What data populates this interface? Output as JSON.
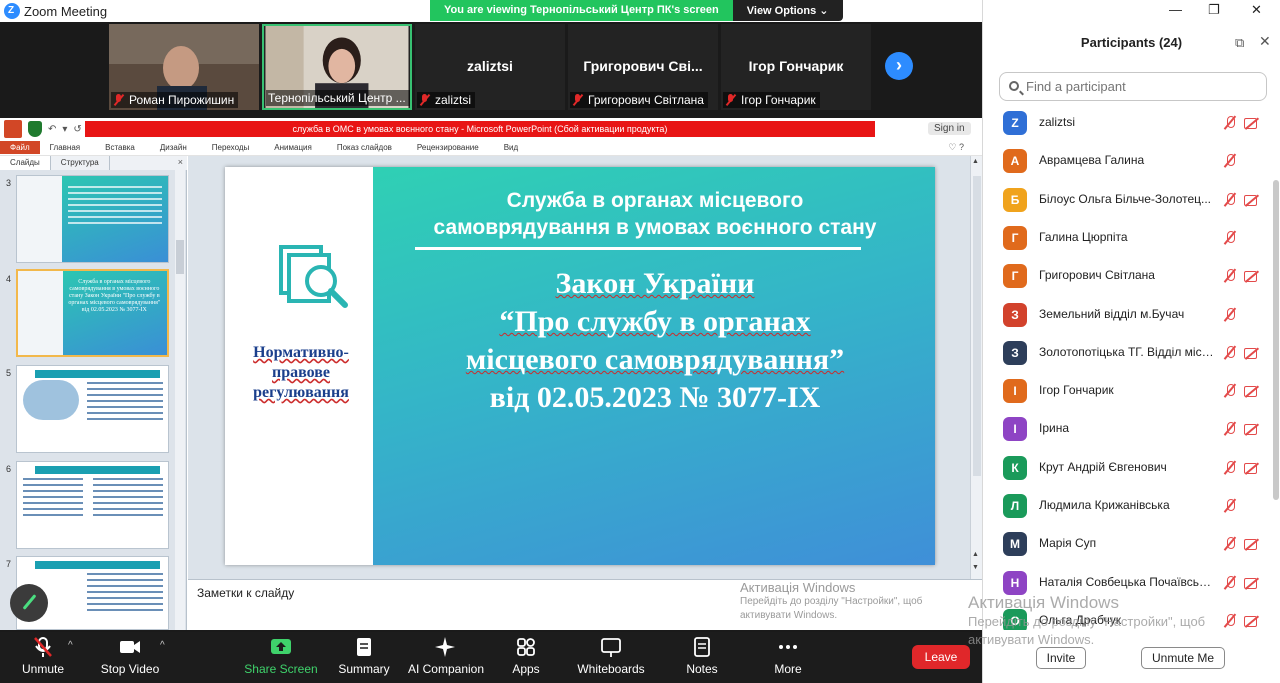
{
  "window": {
    "title": "Zoom Meeting"
  },
  "banner": {
    "message": "You are viewing Тернопільський Центр ПК's screen",
    "options_label": "View Options"
  },
  "window_controls": {
    "minimize": "—",
    "restore": "❐",
    "close": "✕"
  },
  "videos": [
    {
      "name": "Роман Пирожишин",
      "muted": true
    },
    {
      "name": "Тернопільський Центр ...",
      "muted": false,
      "active": true
    },
    {
      "name": "zaliztsi",
      "big_name": "zaliztsi",
      "muted": true
    },
    {
      "name": "Григорович Світлана",
      "big_name": "Григорович  Сві...",
      "muted": true
    },
    {
      "name": "Ігор Гончарик",
      "big_name": "Ігор Гончарик",
      "muted": true
    }
  ],
  "video_next_label": "›",
  "ppt": {
    "window_title": "служба в ОМС в умовах воєнного стану  -  Microsoft PowerPoint (Сбой активации продукта)",
    "sign_in": "Sign in",
    "qat": [
      "↶",
      "▾",
      "↺",
      "▾"
    ],
    "menu": [
      "Файл",
      "Главная",
      "Вставка",
      "Дизайн",
      "Переходы",
      "Анимация",
      "Показ слайдов",
      "Рецензирование",
      "Вид"
    ],
    "help": "♡ ?",
    "panel_tabs": [
      "Слайды",
      "Структура"
    ],
    "panel_close": "×",
    "thumbs": [
      {
        "num": "3"
      },
      {
        "num": "4",
        "text": "Служба в органах місцевого самоврядування в умовах воєнного стану Закон України \"Про службу в органах місцевого самоврядування\" від 02.05.2023 № 3077-IX"
      },
      {
        "num": "5"
      },
      {
        "num": "6"
      },
      {
        "num": "7"
      }
    ],
    "slide": {
      "left_label_lines": [
        "Нормативно-",
        "правове",
        "регулювання"
      ],
      "heading_lines": [
        "Служба в органах місцевого",
        "самоврядування в умовах воєнного стану"
      ],
      "law_lines": [
        "Закон України",
        "“Про службу в органах",
        "місцевого самоврядування”",
        "від 02.05.2023 № 3077-IX"
      ]
    },
    "notes_placeholder": "Заметки к слайду",
    "activation": {
      "title": "Активація Windows",
      "line1": "Перейдіть до розділу \"Настройки\", щоб",
      "line2": "активувати Windows."
    }
  },
  "toolbar": {
    "items": [
      "Unmute",
      "Stop Video",
      "Share Screen",
      "Summary",
      "AI Companion",
      "Apps",
      "Whiteboards",
      "Notes",
      "More"
    ],
    "leave": "Leave",
    "caret": "^"
  },
  "participants": {
    "title": "Participants (24)",
    "search_placeholder": "Find a participant",
    "list": [
      {
        "initial": "Z",
        "name": "zaliztsi",
        "color": "#2f6fd6",
        "mic_muted": true,
        "video_off": true
      },
      {
        "initial": "А",
        "name": "Аврамцева Галина",
        "color": "#e06a1c",
        "mic_muted": true,
        "video_off": false
      },
      {
        "initial": "Б",
        "name": "Білоус Ольга  Більче-Золотец...",
        "color": "#f0a31c",
        "mic_muted": true,
        "video_off": true
      },
      {
        "initial": "Г",
        "name": "Галина Цюрпіта",
        "color": "#e06a1c",
        "mic_muted": true,
        "video_off": false
      },
      {
        "initial": "Г",
        "name": "Григорович Світлана",
        "color": "#e06a1c",
        "mic_muted": true,
        "video_off": true
      },
      {
        "initial": "З",
        "name": "Земельний відділ м.Бучач",
        "color": "#d2422c",
        "mic_muted": true,
        "video_off": false
      },
      {
        "initial": "З",
        "name": "Золотопотіцька ТГ. Відділ міст...",
        "color": "#2d3e5a",
        "mic_muted": true,
        "video_off": true
      },
      {
        "initial": "І",
        "name": "Ігор Гончарик",
        "color": "#e06a1c",
        "mic_muted": true,
        "video_off": true
      },
      {
        "initial": "І",
        "name": "Ірина",
        "color": "#8e44c4",
        "mic_muted": true,
        "video_off": true
      },
      {
        "initial": "К",
        "name": "Крут Андрій Євгенович",
        "color": "#1a9a5a",
        "mic_muted": true,
        "video_off": true
      },
      {
        "initial": "Л",
        "name": "Людмила Крижанівська",
        "color": "#1a9a5a",
        "mic_muted": true,
        "video_off": false
      },
      {
        "initial": "М",
        "name": "Марія Суп",
        "color": "#2d3e5a",
        "mic_muted": true,
        "video_off": true
      },
      {
        "initial": "Н",
        "name": "Наталія Совбецька Почаївська мі...",
        "color": "#8e44c4",
        "mic_muted": true,
        "video_off": true
      },
      {
        "initial": "О",
        "name": "Ольга Драбчук",
        "color": "#1a9a5a",
        "mic_muted": true,
        "video_off": true
      }
    ],
    "invite": "Invite",
    "unmute_me": "Unmute Me"
  },
  "activation_overlay": {
    "title": "Активація Windows",
    "line1": "Перейдіть до розділу \"Настройки\", щоб",
    "line2": "активувати Windows."
  }
}
